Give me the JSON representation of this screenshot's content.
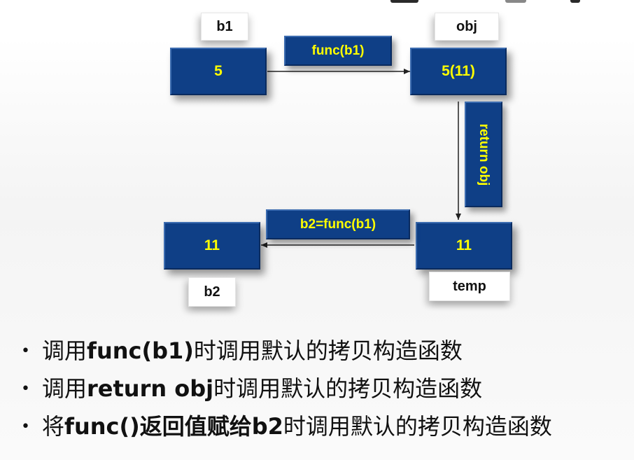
{
  "diagram": {
    "top_tags": {
      "b1": "b1",
      "obj": "obj"
    },
    "bottom_tags": {
      "b2": "b2",
      "temp": "temp"
    },
    "boxes": {
      "b1_value": "5",
      "obj_value": "5(11)",
      "b2_value": "11",
      "temp_value": "11"
    },
    "arrow_labels": {
      "call": "func(b1)",
      "return": "return obj",
      "assign": "b2=func(b1)"
    },
    "colors": {
      "box_fill": "#0f3f86",
      "box_text": "#ffff00",
      "tag_fill": "#ffffff",
      "arrow": "#222222"
    }
  },
  "bullets": [
    {
      "prefix": "调用",
      "bold": "func(b1)",
      "suffix": "时调用默认的拷贝构造函数"
    },
    {
      "prefix": "调用",
      "bold": "return obj",
      "suffix": "时调用默认的拷贝构造函数"
    },
    {
      "prefix": "将",
      "bold": "func()返回值赋给b2",
      "suffix": "时调用默认的拷贝构造函数"
    }
  ]
}
